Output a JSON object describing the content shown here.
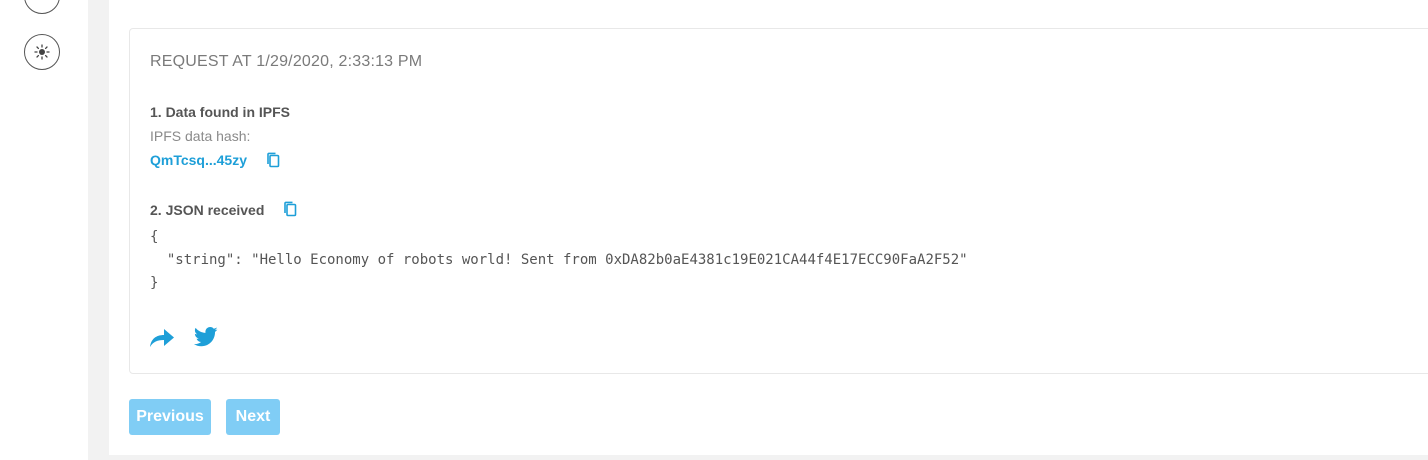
{
  "request": {
    "title": "REQUEST AT 1/29/2020, 2:33:13 PM",
    "step1_title": "1. Data found in IPFS",
    "hash_label": "IPFS data hash:",
    "hash_value": "QmTcsq...45zy",
    "step2_title": "2. JSON received",
    "json_text": "{\n  \"string\": \"Hello Economy of robots world! Sent from 0xDA82b0aE4381c19E021CA44f4E17ECC90FaA2F52\"\n}"
  },
  "pagination": {
    "previous_label": "Previous",
    "next_label": "Next"
  },
  "icons": {
    "theme": "sun-icon",
    "copy": "copy-icon",
    "share": "share-icon",
    "twitter": "twitter-icon"
  },
  "colors": {
    "accent": "#1e9fd8",
    "button_disabled": "#80cdf5"
  }
}
